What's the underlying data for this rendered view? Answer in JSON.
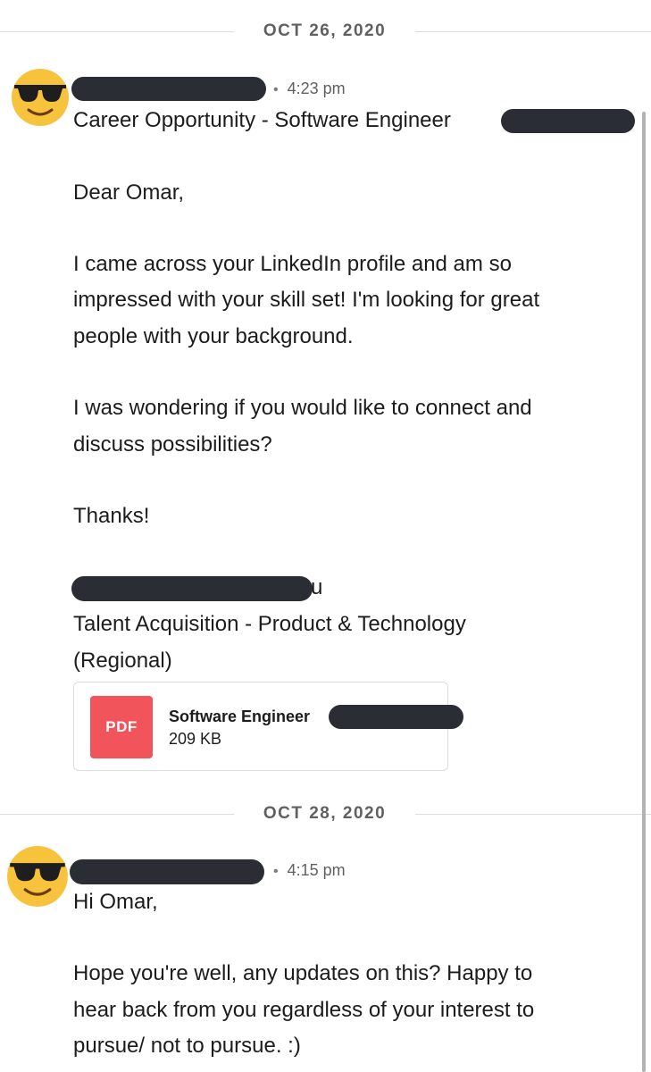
{
  "dividers": [
    {
      "date": "OCT 26, 2020"
    },
    {
      "date": "OCT 28, 2020"
    }
  ],
  "messages": [
    {
      "avatar": "sunglasses-emoji-icon",
      "time": "4:23 pm",
      "lines": [
        "Career Opportunity - Software Engineer",
        "Dear Omar,",
        "I came across your LinkedIn profile and am so",
        "impressed with your skill set! I'm looking for great",
        "people with your background.",
        "I was wondering if you would like to connect and",
        "discuss possibilities?",
        "Thanks!",
        "u",
        "Talent Acquisition - Product & Technology",
        "(Regional)"
      ],
      "attachment": {
        "type_label": "PDF",
        "name": "Software Engineer",
        "size": "209 KB",
        "icon_color": "#f2545b"
      }
    },
    {
      "avatar": "sunglasses-emoji-icon",
      "time": "4:15 pm",
      "lines": [
        "Hi Omar,",
        "Hope you're well, any updates on this? Happy to",
        "hear back from you regardless of your interest to",
        "pursue/ not to pursue. :)"
      ]
    }
  ],
  "colors": {
    "redaction": "#2a2d33",
    "text": "#1d1c1d",
    "meta": "#616061"
  }
}
